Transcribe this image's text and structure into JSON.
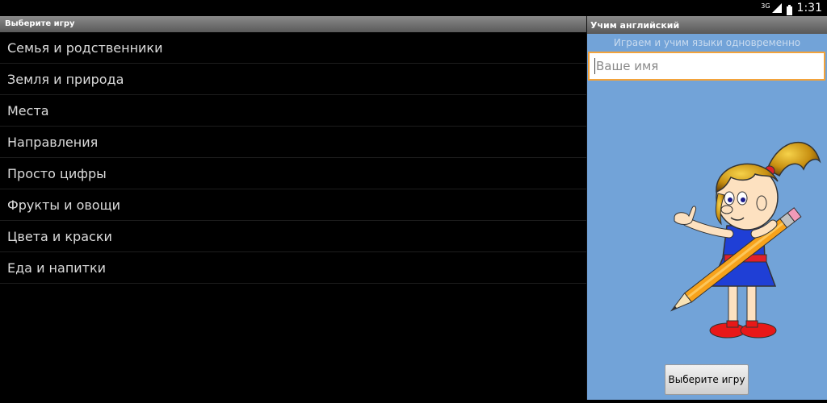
{
  "status_bar": {
    "network_label": "3G",
    "time": "1:31"
  },
  "left_panel": {
    "header": "Выберите игру",
    "items": [
      {
        "label": "Семья и родственники"
      },
      {
        "label": "Земля и природа"
      },
      {
        "label": "Места"
      },
      {
        "label": "Направления"
      },
      {
        "label": "Просто цифры"
      },
      {
        "label": "Фрукты и овощи"
      },
      {
        "label": "Цвета и краски"
      },
      {
        "label": "Еда и напитки"
      }
    ]
  },
  "right_panel": {
    "header": "Учим английский",
    "subtitle": "Играем и учим языки одновременно",
    "name_input": {
      "value": "",
      "placeholder": "Ваше имя"
    },
    "choose_button_label": "Выберите игру",
    "background_color": "#72a3d8",
    "input_focus_color": "#f3a33b"
  },
  "icons": [
    "signal-icon",
    "battery-icon",
    "girl-with-pencil-illustration"
  ]
}
